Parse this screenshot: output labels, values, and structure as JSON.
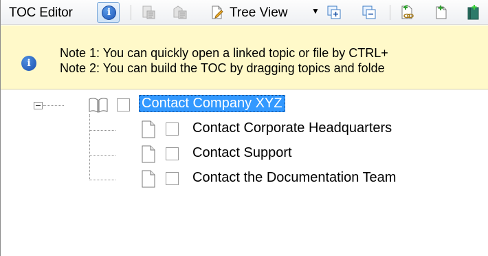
{
  "toolbar": {
    "title": "TOC Editor",
    "view_label": "Tree View",
    "icons": [
      "info-icon",
      "topic-properties-icon",
      "folder-properties-icon",
      "tree-view-icon",
      "expand-all-icon",
      "collapse-all-icon",
      "add-topic-link-icon",
      "new-topic-icon",
      "new-book-icon"
    ]
  },
  "notes": {
    "line1": "Note 1: You can quickly open a linked topic or file by CTRL+",
    "line2": "Note 2: You can build the TOC by dragging topics and folde"
  },
  "tree": {
    "root": {
      "label": "Contact Company XYZ",
      "icon": "book-icon",
      "expanded": true,
      "selected": true
    },
    "children": [
      {
        "label": "Contact Corporate Headquarters",
        "icon": "page-icon"
      },
      {
        "label": "Contact Support",
        "icon": "page-icon"
      },
      {
        "label": "Contact the Documentation Team",
        "icon": "page-icon"
      }
    ]
  },
  "colors": {
    "selection": "#3399ff",
    "notes_bg": "#fff9c9"
  }
}
